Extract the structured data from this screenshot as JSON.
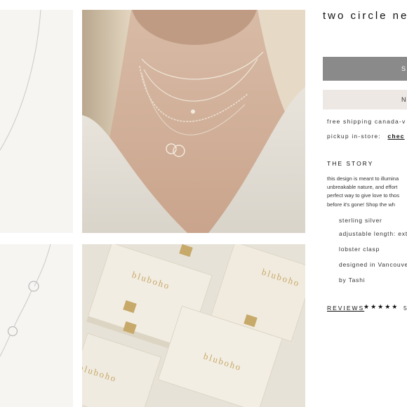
{
  "product": {
    "title": "two circle neck",
    "primary_button_label": "S",
    "secondary_button_label": "N"
  },
  "shipping": {
    "free_shipping_text": "free shipping canada-v",
    "pickup_label": "pickup in-store:",
    "pickup_link": "chec"
  },
  "story": {
    "heading": "THE STORY",
    "lines": [
      "this design is meant to illumina",
      "unbreakable nature, and effort",
      "perfect way to give love to thos",
      "before it's gone! Shop the wh"
    ]
  },
  "details": [
    "sterling silver",
    "adjustable length: ext",
    "lobster clasp",
    "designed in Vancouve",
    "by Tashi"
  ],
  "reviews": {
    "label": "REVIEWS",
    "stars": "★★★★★",
    "rating_text": "5"
  },
  "brand": {
    "box_logo_text": "bluboho"
  },
  "colors": {
    "primary_button": "#8a8a8a",
    "secondary_button": "#ede8e3",
    "thumb_bg": "#f7f5f2",
    "box_color": "#efe9dc",
    "gold": "#c7a96a"
  }
}
